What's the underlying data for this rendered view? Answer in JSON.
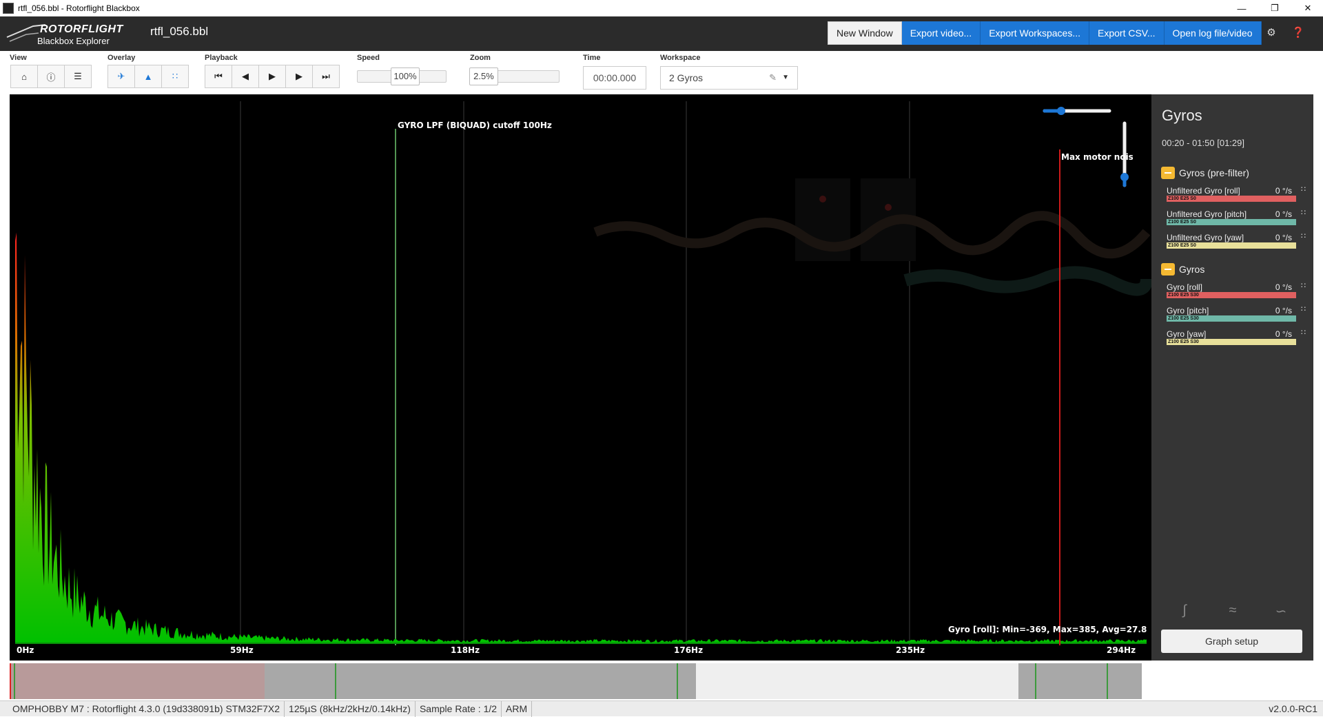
{
  "window": {
    "title": "rtfl_056.bbl - Rotorflight Blackbox"
  },
  "header": {
    "logo_line1": "ROTORFLIGHT",
    "logo_line2": "Blackbox Explorer",
    "filename": "rtfl_056.bbl",
    "buttons": [
      "New Window",
      "Export video...",
      "Export Workspaces...",
      "Export CSV...",
      "Open log file/video"
    ],
    "icons": [
      "gear-icon",
      "help-icon"
    ]
  },
  "toolbar": {
    "view_label": "View",
    "overlay_label": "Overlay",
    "playback_label": "Playback",
    "speed_label": "Speed",
    "speed_value": "100%",
    "zoom_label": "Zoom",
    "zoom_value": "2.5%",
    "time_label": "Time",
    "time_value": "00:00.000",
    "workspace_label": "Workspace",
    "workspace_value": "2 Gyros"
  },
  "graph": {
    "lpf_label": "GYRO LPF (BIQUAD) cutoff 100Hz",
    "max_motor_label": "Max motor noise",
    "stats": "Gyro [roll]: Min=-369, Max=385, Avg=27.8",
    "freq_labels": [
      "0Hz",
      "59Hz",
      "118Hz",
      "176Hz",
      "235Hz",
      "294Hz"
    ],
    "colors": {
      "spectrum_low": "#00c000",
      "spectrum_high": "#ff2020",
      "marker": "#cc1a1a",
      "grid": "#444444"
    }
  },
  "sidepanel": {
    "title": "Gyros",
    "range": "00:20 - 01:50 [01:29]",
    "groups": [
      {
        "name": "Gyros (pre-filter)",
        "fields": [
          {
            "name": "Unfiltered Gyro [roll]",
            "value": "0 °/s",
            "bar": "Z100 E25 S0",
            "color": "#e06060"
          },
          {
            "name": "Unfiltered Gyro [pitch]",
            "value": "0 °/s",
            "bar": "Z100 E25 S0",
            "color": "#6fb8a8"
          },
          {
            "name": "Unfiltered Gyro [yaw]",
            "value": "0 °/s",
            "bar": "Z100 E25 S0",
            "color": "#e8e09a"
          }
        ]
      },
      {
        "name": "Gyros",
        "fields": [
          {
            "name": "Gyro [roll]",
            "value": "0 °/s",
            "bar": "Z100 E25 S30",
            "color": "#e06060"
          },
          {
            "name": "Gyro [pitch]",
            "value": "0 °/s",
            "bar": "Z100 E25 S30",
            "color": "#6fb8a8"
          },
          {
            "name": "Gyro [yaw]",
            "value": "0 °/s",
            "bar": "Z100 E25 S30",
            "color": "#e8e09a"
          }
        ]
      }
    ],
    "graph_setup": "Graph setup"
  },
  "statusbar": {
    "cells": [
      "OMPHOBBY M7 : Rotorflight 4.3.0 (19d338091b) STM32F7X2",
      "125µS (8kHz/2kHz/0.14kHz)",
      "Sample Rate : 1/2",
      "ARM"
    ],
    "version": "v2.0.0-RC1"
  }
}
